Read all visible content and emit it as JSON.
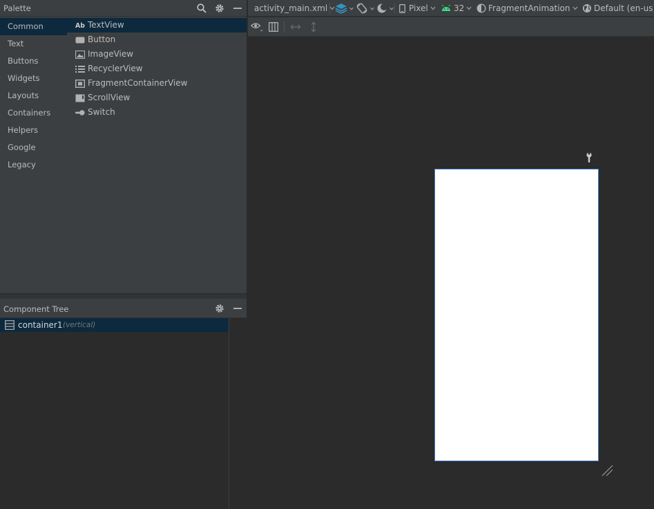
{
  "palette": {
    "title": "Palette",
    "categories": [
      {
        "label": "Common",
        "selected": true
      },
      {
        "label": "Text"
      },
      {
        "label": "Buttons"
      },
      {
        "label": "Widgets"
      },
      {
        "label": "Layouts"
      },
      {
        "label": "Containers"
      },
      {
        "label": "Helpers"
      },
      {
        "label": "Google"
      },
      {
        "label": "Legacy"
      }
    ],
    "widgets": [
      {
        "label": "TextView",
        "icon": "textview-icon",
        "selected": true
      },
      {
        "label": "Button",
        "icon": "button-icon"
      },
      {
        "label": "ImageView",
        "icon": "imageview-icon"
      },
      {
        "label": "RecyclerView",
        "icon": "recyclerview-icon"
      },
      {
        "label": "FragmentContainerView",
        "icon": "fragment-container-icon"
      },
      {
        "label": "ScrollView",
        "icon": "scrollview-icon"
      },
      {
        "label": "Switch",
        "icon": "switch-icon"
      }
    ],
    "icons": [
      "search-icon",
      "gear-icon",
      "minimize-icon"
    ]
  },
  "component_tree": {
    "title": "Component Tree",
    "rows": [
      {
        "label": "container1",
        "hint": "(vertical)",
        "icon": "linear-layout-icon"
      }
    ]
  },
  "toolbar": {
    "file": "activity_main.xml",
    "device": "Pixel",
    "api": "32",
    "theme": "FragmentAnimation",
    "locale": "Default (en-us)"
  },
  "colors": {
    "panel_bg": "#3c3f41",
    "canvas_bg": "#2b2b2b",
    "selection": "#0d293e",
    "accent_blue": "#3d7bc9",
    "android_green": "#3ddc84",
    "layers_blue": "#3592c4"
  }
}
